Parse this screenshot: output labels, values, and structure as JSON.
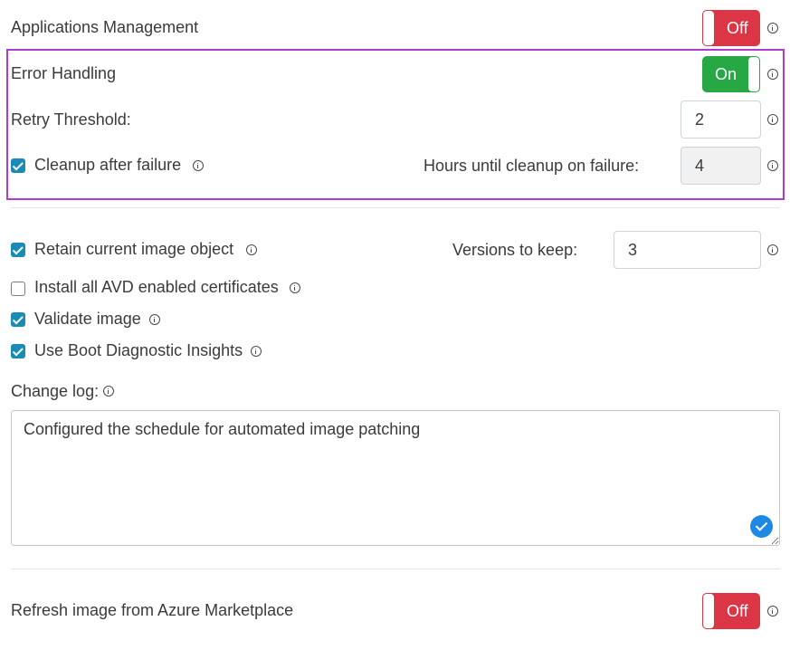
{
  "app_management": {
    "label": "Applications Management",
    "toggle": "Off"
  },
  "error_handling": {
    "label": "Error Handling",
    "toggle": "On",
    "retry_label": "Retry Threshold:",
    "retry_value": "2",
    "cleanup_label": "Cleanup after failure",
    "cleanup_checked": true,
    "hours_label": "Hours until cleanup on failure:",
    "hours_value": "4"
  },
  "retain": {
    "label": "Retain current image object",
    "checked": true,
    "versions_label": "Versions to keep:",
    "versions_value": "3"
  },
  "install_certs": {
    "label": "Install all AVD enabled certificates",
    "checked": false
  },
  "validate_image": {
    "label": "Validate image",
    "checked": true
  },
  "boot_diag": {
    "label": "Use Boot Diagnostic Insights",
    "checked": true
  },
  "change_log": {
    "label": "Change log:",
    "value": "Configured the schedule for automated image patching"
  },
  "refresh": {
    "label": "Refresh image from Azure Marketplace",
    "toggle": "Off"
  },
  "colors": {
    "off": "#dc3545",
    "on": "#28a745",
    "checkbox": "#1a8bb6",
    "highlight": "#b13ad0"
  },
  "icons": [
    "info-icon",
    "check-icon",
    "validation-check-icon",
    "resize-handle-icon"
  ]
}
